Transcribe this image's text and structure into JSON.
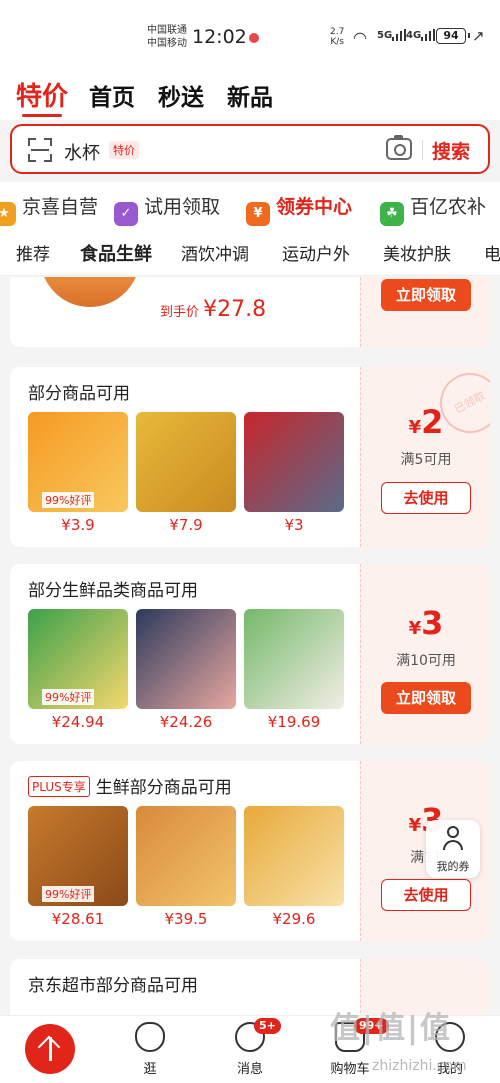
{
  "status": {
    "carrier_1": "中国联通",
    "carrier_2": "中国移动",
    "time": "12:02",
    "net_speed_value": "2.7",
    "net_speed_unit": "K/s",
    "sig_1": "5G",
    "sig_2": "4G",
    "battery": "94"
  },
  "top_tabs": [
    "特价",
    "首页",
    "秒送",
    "新品"
  ],
  "search": {
    "value": "水杯",
    "tag": "特价",
    "button": "搜索"
  },
  "channels": [
    {
      "label": "京喜自营",
      "icon": "jingxi-icon",
      "color": "#f0a020"
    },
    {
      "label": "试用领取",
      "icon": "gift-icon",
      "color": "#9b59d0"
    },
    {
      "label": "领券中心",
      "icon": "coupon-icon",
      "color": "#f06a1e",
      "hot": true
    },
    {
      "label": "百亿农补",
      "icon": "farm-icon",
      "color": "#3db34a"
    }
  ],
  "categories": [
    "推荐",
    "食品生鲜",
    "酒饮冲调",
    "运动户外",
    "美妆护肤",
    "电"
  ],
  "coupons": [
    {
      "deal_prefix": "到手价",
      "deal_price": "¥27.8",
      "button": "立即领取"
    },
    {
      "title": "部分商品可用",
      "stamp": "已领取",
      "products": [
        {
          "price": "¥3.9",
          "badge": "99%好评",
          "colors": [
            "#f59a23",
            "#f7c85c"
          ]
        },
        {
          "price": "¥7.9",
          "badge": "",
          "colors": [
            "#e8b93a",
            "#c98b20"
          ]
        },
        {
          "price": "¥3",
          "badge": "",
          "colors": [
            "#c8262c",
            "#5a6b8a"
          ]
        }
      ],
      "amount_symbol": "¥",
      "amount": "2",
      "condition": "满5可用",
      "button": "去使用"
    },
    {
      "title": "部分生鲜品类商品可用",
      "products": [
        {
          "price": "¥24.94",
          "badge": "99%好评",
          "colors": [
            "#3da14a",
            "#f5d76e"
          ]
        },
        {
          "price": "¥24.26",
          "badge": "",
          "colors": [
            "#2c3a5c",
            "#e7a7a0"
          ]
        },
        {
          "price": "¥19.69",
          "badge": "",
          "colors": [
            "#74b96a",
            "#f2ede4"
          ]
        }
      ],
      "amount_symbol": "¥",
      "amount": "3",
      "condition": "满10可用",
      "button": "立即领取"
    },
    {
      "tag": "PLUS专享",
      "title": "生鲜部分商品可用",
      "products": [
        {
          "price": "¥28.61",
          "badge": "99%好评",
          "colors": [
            "#c77a2c",
            "#8a4a18"
          ]
        },
        {
          "price": "¥39.5",
          "badge": "",
          "colors": [
            "#d98a3a",
            "#f2c46b"
          ]
        },
        {
          "price": "¥29.6",
          "badge": "",
          "colors": [
            "#e8a93a",
            "#f7e2a8"
          ]
        }
      ],
      "amount_symbol": "¥",
      "amount": "3",
      "condition": "满11",
      "button": "去使用"
    },
    {
      "title": "京东超市部分商品可用"
    }
  ],
  "my_coupon": "我的券",
  "bottom_nav": [
    {
      "label": "逛",
      "badge": ""
    },
    {
      "label": "消息",
      "badge": "5+"
    },
    {
      "label": "购物车",
      "badge": "99+"
    },
    {
      "label": "我的",
      "badge": ""
    }
  ],
  "watermark": {
    "main": "值|值|值",
    "sub": "zhizhizhi.com"
  }
}
